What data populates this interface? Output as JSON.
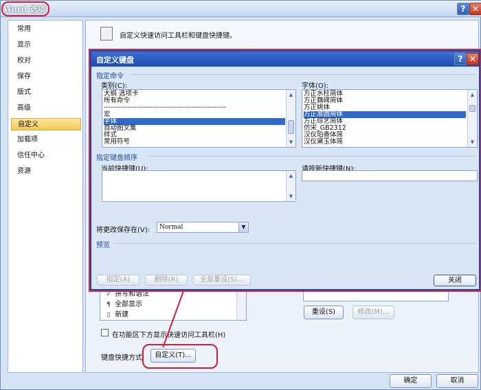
{
  "window": {
    "title": "Word 选项",
    "help_label": "?",
    "close_label": "✕"
  },
  "nav": {
    "items": [
      {
        "label": "常用"
      },
      {
        "label": "显示"
      },
      {
        "label": "校对"
      },
      {
        "label": "保存"
      },
      {
        "label": "版式"
      },
      {
        "label": "高级"
      },
      {
        "label": "自定义"
      },
      {
        "label": "加载项"
      },
      {
        "label": "信任中心"
      },
      {
        "label": "资源"
      }
    ],
    "selected": "自定义"
  },
  "content": {
    "header_text": "自定义快速访问工具栏和键盘快捷键。",
    "bg_list": [
      {
        "icon": "spell-check-icon",
        "glyph": "✓",
        "label": "拼写和语法"
      },
      {
        "icon": "show-all-icon",
        "glyph": "¶",
        "label": "全部显示"
      },
      {
        "icon": "new-document-icon",
        "glyph": "▯",
        "label": "新建"
      }
    ],
    "reset_button": "重设(S)",
    "modify_button": "修改(M)...",
    "show_below_ribbon": "在功能区下方显示快速访问工具栏(H)",
    "keyboard_shortcut_label": "键盘快捷方式:",
    "customize_button": "自定义(T)...",
    "ok_button": "确定",
    "cancel_button": "取消"
  },
  "dialog": {
    "title": "自定义键盘",
    "help_label": "?",
    "close_label": "✕",
    "section_command": "指定命令",
    "category_label": "类别(C):",
    "categories": [
      "大纲 选项卡",
      "所有命令",
      "----------------------------------------------------",
      "宏",
      "字体",
      "自动图文集",
      "样式",
      "常用符号"
    ],
    "category_selected": "字体",
    "font_label": "字体(O):",
    "fonts": [
      "方正水柱简体",
      "方正魏碑简体",
      "方正姚体",
      "方正准圆简体",
      "方正综艺简体",
      "仿宋_GB2312",
      "汉仪珀香体简",
      "汉仪黛玉体简"
    ],
    "font_selected": "方正准圆简体",
    "section_keyboard": "指定键盘顺序",
    "current_keys_label": "当前快捷键(U):",
    "new_key_label": "请按新快捷键(N):",
    "save_in_label": "将更改保存在(V):",
    "save_in_value": "Normal",
    "section_preview": "预览",
    "assign_button": "指定(A)",
    "remove_button": "删除(R)",
    "reset_all_button": "全部重设(S)...",
    "close_button": "关闭"
  },
  "colors": {
    "annotation": "#d41c3a",
    "selection": "#3169c6",
    "nav_selected": "#f4c85a"
  }
}
